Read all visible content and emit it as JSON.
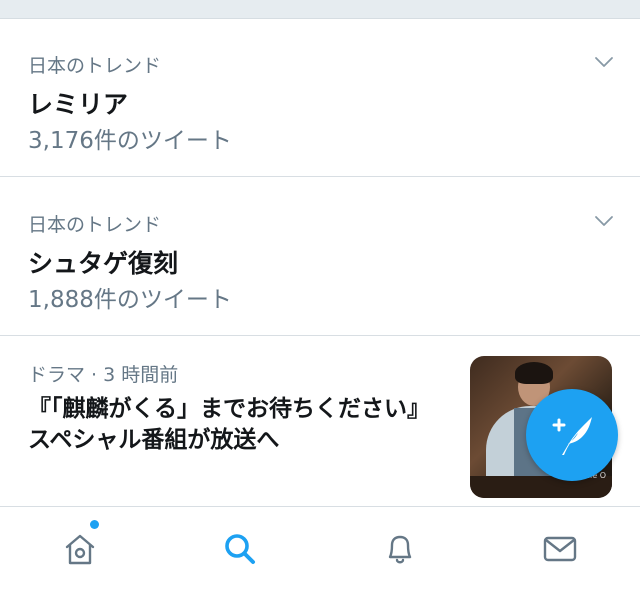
{
  "trends": [
    {
      "context": "日本のトレンド",
      "title": "レミリア",
      "count": "3,176件のツイート"
    },
    {
      "context": "日本のトレンド",
      "title": "シュタゲ復刻",
      "count": "1,888件のツイート"
    }
  ],
  "news": {
    "context": "ドラマ · 3 時間前",
    "title": "『「麒麟がくる」までお待ちください』スペシャル番組が放送へ",
    "watermark": "File O"
  },
  "tabbar": {
    "items": [
      "home-icon",
      "search-icon",
      "notifications-icon",
      "messages-icon"
    ],
    "active": "search-icon",
    "home_badge": true
  },
  "colors": {
    "accent": "#1da1f2",
    "muted": "#657786",
    "text": "#14171a",
    "icon": "#657786"
  }
}
